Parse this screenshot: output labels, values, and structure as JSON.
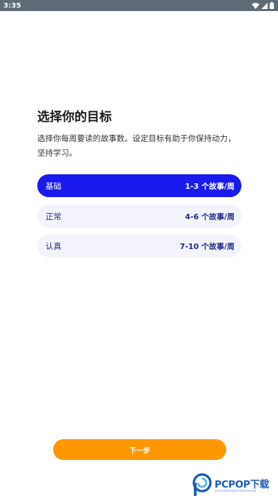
{
  "status_bar": {
    "time": "3:35",
    "icons": [
      "wifi-icon",
      "signal-icon",
      "battery-icon"
    ]
  },
  "title": "选择你的目标",
  "subtitle": "选择你每周要读的故事数。设定目标有助于你保持动力，坚持学习。",
  "options": [
    {
      "label": "基础",
      "value": "1-3 个故事/周",
      "selected": true
    },
    {
      "label": "正常",
      "value": "4-6 个故事/周",
      "selected": false
    },
    {
      "label": "认真",
      "value": "7-10 个故事/周",
      "selected": false
    }
  ],
  "next_button": {
    "label": "下一步"
  },
  "watermark": {
    "text": "PCPOP下载"
  },
  "colors": {
    "status_bar": "#5f6b77",
    "selected": "#1a1aee",
    "unselected": "#f3f3fb",
    "option_text": "#1f2a8a",
    "button": "#ff9800",
    "watermark": "#1e5fb4"
  }
}
